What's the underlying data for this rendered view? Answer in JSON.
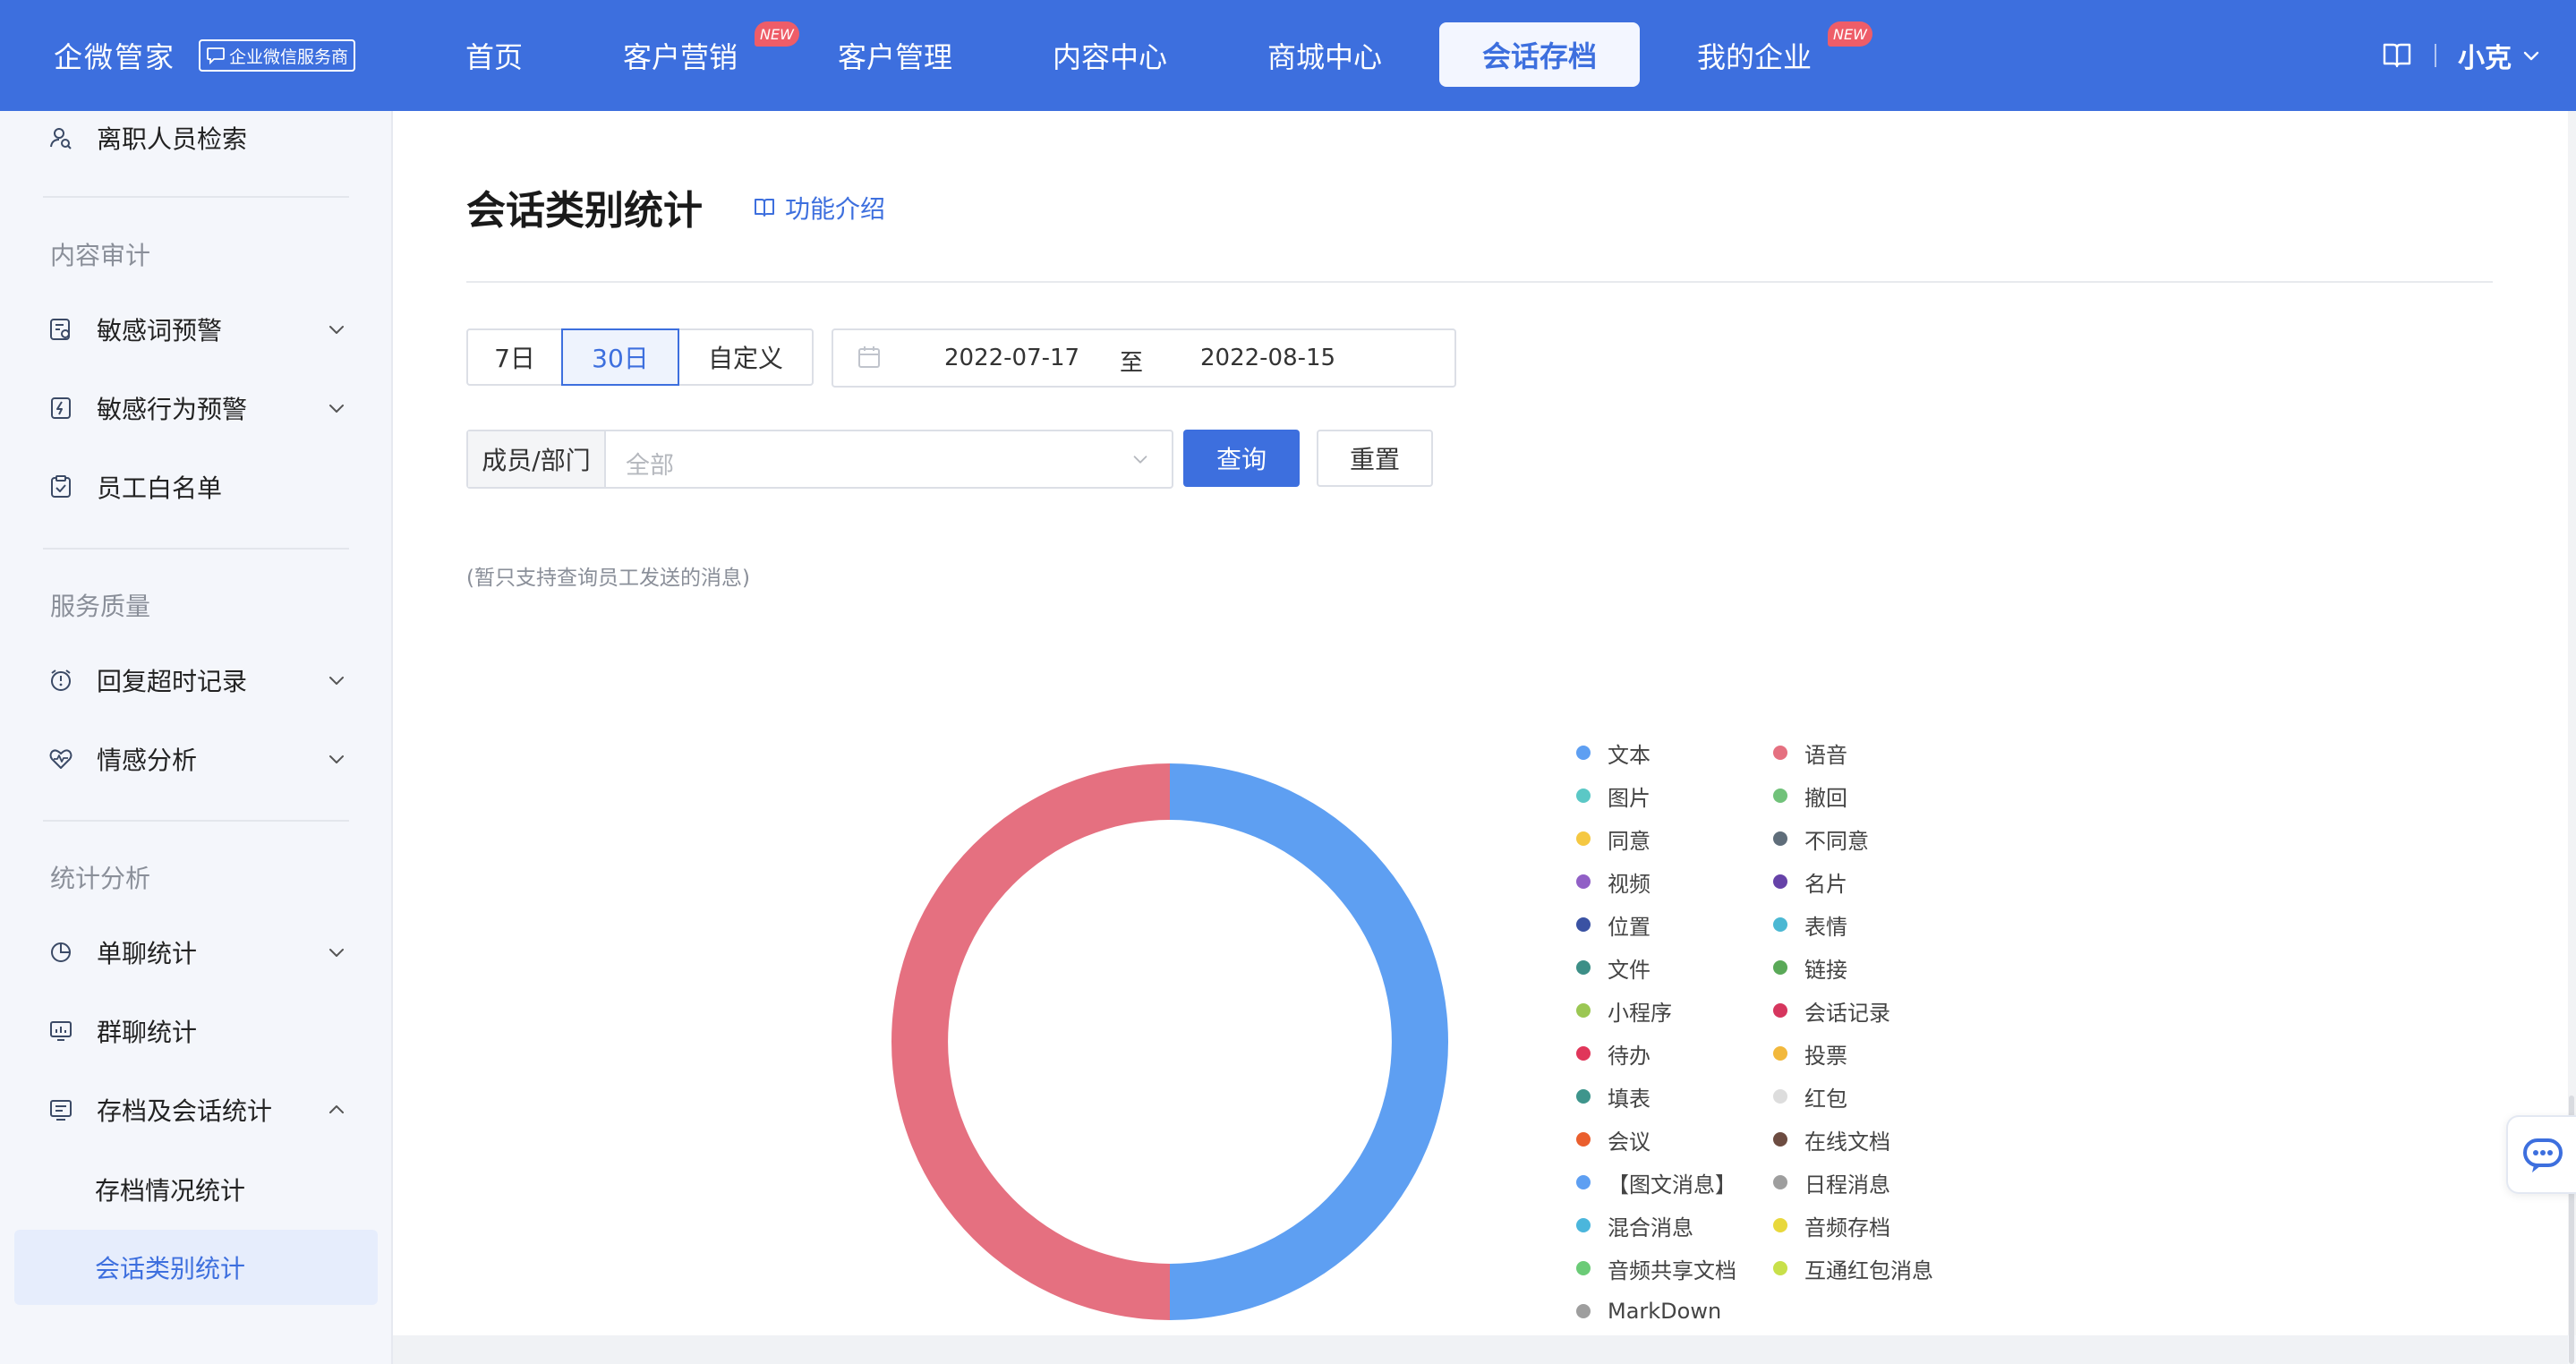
{
  "topnav": {
    "brand": "企微管家",
    "brand_badge": "企业微信服务商",
    "items": [
      {
        "label": "首页",
        "active": false
      },
      {
        "label": "客户营销",
        "active": false,
        "badge": "NEW"
      },
      {
        "label": "客户管理",
        "active": false
      },
      {
        "label": "内容中心",
        "active": false
      },
      {
        "label": "商城中心",
        "active": false
      },
      {
        "label": "会话存档",
        "active": true
      },
      {
        "label": "我的企业",
        "active": false,
        "badge": "NEW"
      }
    ],
    "user": "小克"
  },
  "sidebar": {
    "top_item": {
      "label": "离职人员检索",
      "icon": "user-search-icon"
    },
    "groups": [
      {
        "title": "内容审计",
        "items": [
          {
            "label": "敏感词预警",
            "icon": "sensitive-word-icon",
            "expandable": true
          },
          {
            "label": "敏感行为预警",
            "icon": "sensitive-behavior-icon",
            "expandable": true
          },
          {
            "label": "员工白名单",
            "icon": "clipboard-check-icon",
            "expandable": false
          }
        ]
      },
      {
        "title": "服务质量",
        "items": [
          {
            "label": "回复超时记录",
            "icon": "clock-alert-icon",
            "expandable": true
          },
          {
            "label": "情感分析",
            "icon": "heart-pulse-icon",
            "expandable": true
          }
        ]
      },
      {
        "title": "统计分析",
        "items": [
          {
            "label": "单聊统计",
            "icon": "pie-chart-icon",
            "expandable": true
          },
          {
            "label": "群聊统计",
            "icon": "monitor-chart-icon",
            "expandable": false
          },
          {
            "label": "存档及会话统计",
            "icon": "archive-list-icon",
            "expandable": true,
            "expanded": true,
            "children": [
              {
                "label": "存档情况统计",
                "active": false
              },
              {
                "label": "会话类别统计",
                "active": true
              }
            ]
          }
        ]
      }
    ]
  },
  "main": {
    "title": "会话类别统计",
    "feature_link": "功能介绍",
    "range_buttons": [
      {
        "label": "7日",
        "active": false
      },
      {
        "label": "30日",
        "active": true
      },
      {
        "label": "自定义",
        "active": false
      }
    ],
    "date_start": "2022-07-17",
    "date_sep": "至",
    "date_end": "2022-08-15",
    "member_label": "成员/部门",
    "member_placeholder": "全部",
    "query_button": "查询",
    "reset_button": "重置",
    "note": "(暂只支持查询员工发送的消息)"
  },
  "colors": {
    "primary": "#3d6fde",
    "nav_bg": "#3d6fde",
    "badge_new": "#ee5d68"
  },
  "chart_data": {
    "type": "pie",
    "variant": "donut",
    "legend_position": "right",
    "slices": [
      {
        "name": "文本",
        "value": 50,
        "color": "#5e9ff2"
      },
      {
        "name": "语音",
        "value": 50,
        "color": "#e57080"
      }
    ],
    "legend": [
      {
        "name": "文本",
        "color": "#5e9ff2"
      },
      {
        "name": "语音",
        "color": "#e57080"
      },
      {
        "name": "图片",
        "color": "#5bc8c6"
      },
      {
        "name": "撤回",
        "color": "#71c27a"
      },
      {
        "name": "同意",
        "color": "#f5c842"
      },
      {
        "name": "不同意",
        "color": "#5f6d7a"
      },
      {
        "name": "视频",
        "color": "#9160c6"
      },
      {
        "name": "名片",
        "color": "#6642a8"
      },
      {
        "name": "位置",
        "color": "#3a52a3"
      },
      {
        "name": "表情",
        "color": "#4bb8d3"
      },
      {
        "name": "文件",
        "color": "#3d8f87"
      },
      {
        "name": "链接",
        "color": "#5aa958"
      },
      {
        "name": "小程序",
        "color": "#9bc753"
      },
      {
        "name": "会话记录",
        "color": "#d6365e"
      },
      {
        "name": "待办",
        "color": "#e0365a"
      },
      {
        "name": "投票",
        "color": "#f2b83c"
      },
      {
        "name": "填表",
        "color": "#3e958c"
      },
      {
        "name": "红包",
        "color": "#dddddd"
      },
      {
        "name": "会议",
        "color": "#ea5f2e"
      },
      {
        "name": "在线文档",
        "color": "#6d4c41"
      },
      {
        "name": "【图文消息】",
        "color": "#5e9ff2"
      },
      {
        "name": "日程消息",
        "color": "#9e9e9e"
      },
      {
        "name": "混合消息",
        "color": "#4bb6dc"
      },
      {
        "name": "音频存档",
        "color": "#e8d83c"
      },
      {
        "name": "音频共享文档",
        "color": "#6bcb77"
      },
      {
        "name": "互通红包消息",
        "color": "#c8e04a"
      },
      {
        "name": "MarkDown",
        "color": "#9e9e9e"
      }
    ]
  }
}
